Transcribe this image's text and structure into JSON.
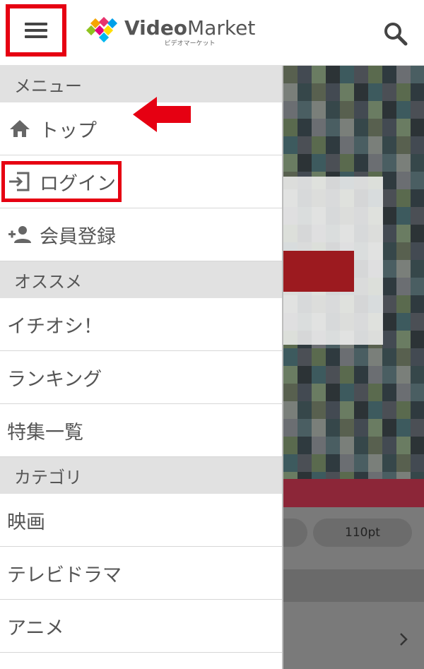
{
  "header": {
    "logo_main_a": "Video",
    "logo_main_b": "Market",
    "logo_sub": "ビデオマーケット",
    "menu_icon": "hamburger-icon",
    "search_icon": "search-icon"
  },
  "drawer": {
    "sections": [
      {
        "title": "メニュー",
        "items": [
          {
            "label": "トップ",
            "icon": "home-icon"
          },
          {
            "label": "ログイン",
            "icon": "login-icon"
          },
          {
            "label": "会員登録",
            "icon": "add-person-icon"
          }
        ]
      },
      {
        "title": "オススメ",
        "items": [
          {
            "label": "イチオシ！"
          },
          {
            "label": "ランキング"
          },
          {
            "label": "特集一覧"
          }
        ]
      },
      {
        "title": "カテゴリ",
        "items": [
          {
            "label": "映画"
          },
          {
            "label": "テレビドラマ"
          },
          {
            "label": "アニメ"
          }
        ]
      }
    ]
  },
  "background": {
    "price_pill": "110pt"
  },
  "colors": {
    "highlight": "#e60012",
    "section_bg": "#e1e1e1",
    "text": "#555555"
  }
}
